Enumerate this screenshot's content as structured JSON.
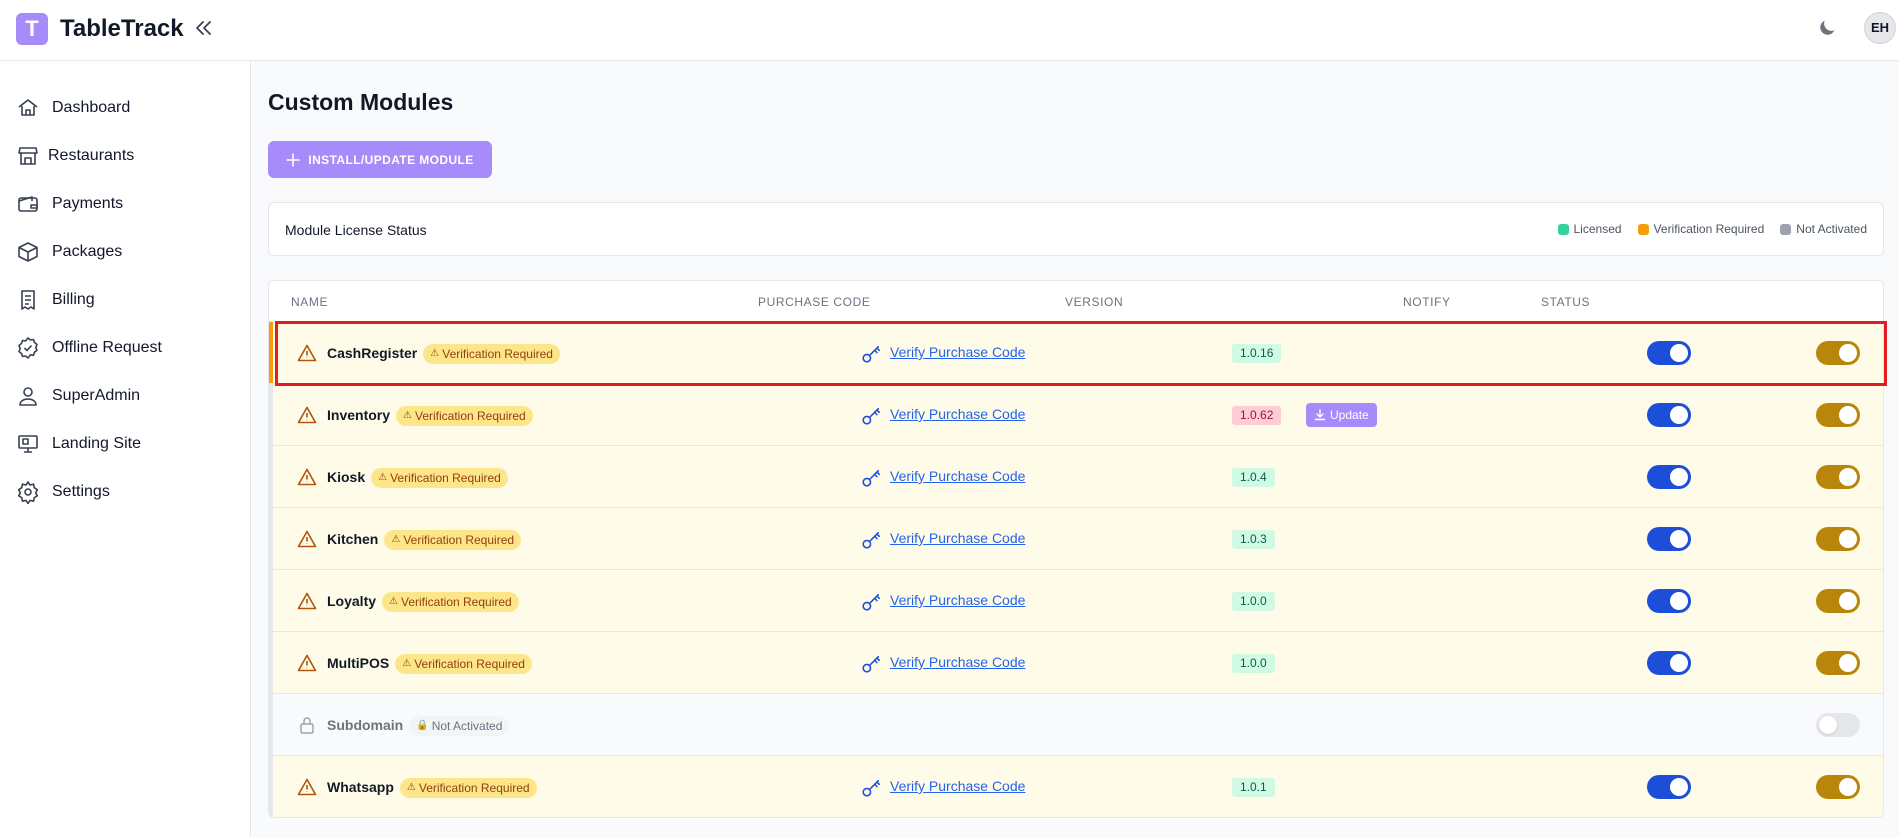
{
  "app": {
    "logo_letter": "T",
    "title": "TableTrack",
    "avatar_initials": "EH"
  },
  "sidebar": {
    "items": [
      {
        "label": "Dashboard",
        "icon": "home-icon"
      },
      {
        "label": "Restaurants",
        "icon": "store-icon"
      },
      {
        "label": "Payments",
        "icon": "wallet-icon"
      },
      {
        "label": "Packages",
        "icon": "box-icon"
      },
      {
        "label": "Billing",
        "icon": "receipt-icon"
      },
      {
        "label": "Offline Request",
        "icon": "check-badge-icon"
      },
      {
        "label": "SuperAdmin",
        "icon": "user-icon"
      },
      {
        "label": "Landing Site",
        "icon": "monitor-icon"
      },
      {
        "label": "Settings",
        "icon": "gear-icon"
      }
    ]
  },
  "main": {
    "title": "Custom Modules",
    "install_button": "INSTALL/UPDATE MODULE",
    "license_card": {
      "title": "Module License Status",
      "legend": [
        {
          "label": "Licensed",
          "color": "#34d399"
        },
        {
          "label": "Verification Required",
          "color": "#f59e0b"
        },
        {
          "label": "Not Activated",
          "color": "#9ca3af"
        }
      ]
    },
    "table": {
      "headers": {
        "name": "NAME",
        "purchase_code": "PURCHASE CODE",
        "version": "VERSION",
        "notify": "NOTIFY",
        "status": "STATUS"
      },
      "rows": [
        {
          "name": "CashRegister",
          "badge": "Verification Required",
          "link": "Verify Purchase Code",
          "version": "1.0.16",
          "outdated": false,
          "notify": true,
          "status": true,
          "state": "verification"
        },
        {
          "name": "Inventory",
          "badge": "Verification Required",
          "link": "Verify Purchase Code",
          "version": "1.0.62",
          "outdated": true,
          "update_label": "Update",
          "notify": true,
          "status": true,
          "state": "verification"
        },
        {
          "name": "Kiosk",
          "badge": "Verification Required",
          "link": "Verify Purchase Code",
          "version": "1.0.4",
          "outdated": false,
          "notify": true,
          "status": true,
          "state": "verification"
        },
        {
          "name": "Kitchen",
          "badge": "Verification Required",
          "link": "Verify Purchase Code",
          "version": "1.0.3",
          "outdated": false,
          "notify": true,
          "status": true,
          "state": "verification"
        },
        {
          "name": "Loyalty",
          "badge": "Verification Required",
          "link": "Verify Purchase Code",
          "version": "1.0.0",
          "outdated": false,
          "notify": true,
          "status": true,
          "state": "verification"
        },
        {
          "name": "MultiPOS",
          "badge": "Verification Required",
          "link": "Verify Purchase Code",
          "version": "1.0.0",
          "outdated": false,
          "notify": true,
          "status": true,
          "state": "verification"
        },
        {
          "name": "Subdomain",
          "badge": "Not Activated",
          "status": false,
          "state": "inactive"
        },
        {
          "name": "Whatsapp",
          "badge": "Verification Required",
          "link": "Verify Purchase Code",
          "version": "1.0.1",
          "outdated": false,
          "notify": true,
          "status": true,
          "state": "verification"
        }
      ]
    }
  }
}
